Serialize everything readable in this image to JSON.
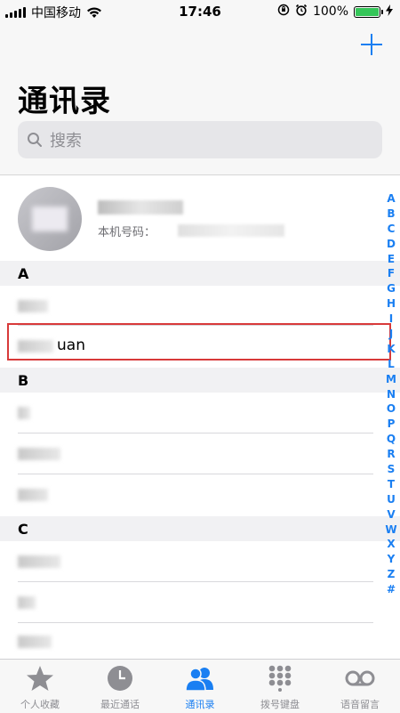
{
  "status_bar": {
    "carrier": "中国移动",
    "time": "17:46",
    "battery": "100%",
    "battery_level": 100
  },
  "header": {
    "add_label": "+",
    "title": "通讯录",
    "search_placeholder": "搜索"
  },
  "my_card": {
    "number_label": "本机号码："
  },
  "sections": {
    "a": {
      "letter": "A",
      "rows": [
        {
          "name": ""
        },
        {
          "name": "uan"
        }
      ]
    },
    "b": {
      "letter": "B"
    },
    "c": {
      "letter": "C"
    }
  },
  "index_letters": [
    "A",
    "B",
    "C",
    "D",
    "E",
    "F",
    "G",
    "H",
    "I",
    "J",
    "K",
    "L",
    "M",
    "N",
    "O",
    "P",
    "Q",
    "R",
    "S",
    "T",
    "U",
    "V",
    "W",
    "X",
    "Y",
    "Z",
    "#"
  ],
  "tab_bar": {
    "favorites": "个人收藏",
    "recents": "最近通话",
    "contacts": "通讯录",
    "keypad": "拨号键盘",
    "voicemail": "语音留言"
  },
  "colors": {
    "accent": "#1a7ff2",
    "highlight_border": "#d83a3a",
    "battery_fill": "#35c659"
  }
}
